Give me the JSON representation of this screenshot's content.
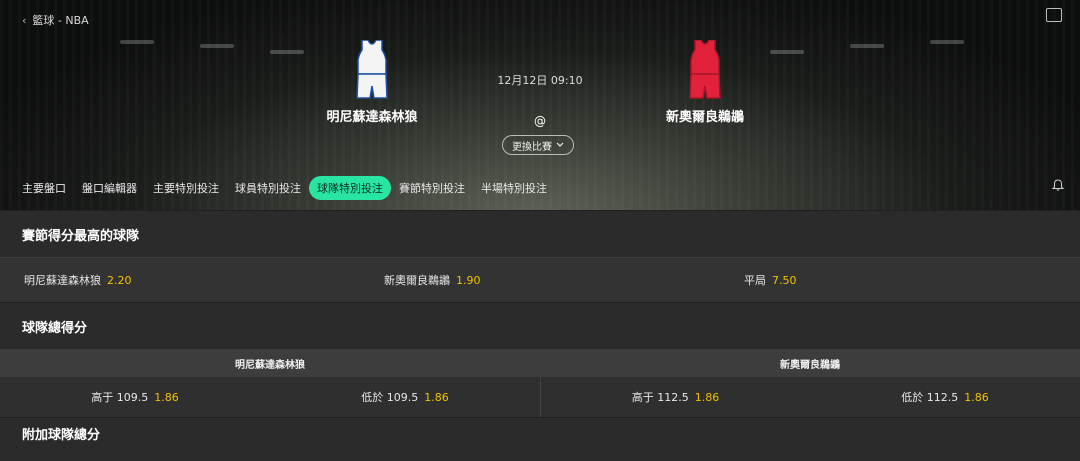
{
  "breadcrumb": "籃球 - NBA",
  "home_team": {
    "name": "明尼蘇達森林狼",
    "jersey_color": "#f4f4f4",
    "trim_color": "#1f4fa0"
  },
  "away_team": {
    "name": "新奧爾良鵜鶘",
    "jersey_color": "#e2223a",
    "trim_color": "#a8162a"
  },
  "match_time": "12月12日 09:10",
  "at_symbol": "@",
  "switch_match_label": "更換比賽",
  "tabs": [
    {
      "label": "主要盤口",
      "active": false
    },
    {
      "label": "盤口編輯器",
      "active": false
    },
    {
      "label": "主要特別投注",
      "active": false
    },
    {
      "label": "球員特別投注",
      "active": false
    },
    {
      "label": "球隊特別投注",
      "active": true
    },
    {
      "label": "賽節特別投注",
      "active": false
    },
    {
      "label": "半場特別投注",
      "active": false
    }
  ],
  "accent_color": "#28e6a2",
  "odds_color": "#f2c200",
  "section_top_quarter": {
    "title": "賽節得分最高的球隊",
    "options": [
      {
        "label": "明尼蘇達森林狼",
        "odds": "2.20"
      },
      {
        "label": "新奧爾良鵜鶘",
        "odds": "1.90"
      },
      {
        "label": "平局",
        "odds": "7.50"
      }
    ]
  },
  "section_team_total": {
    "title": "球隊總得分",
    "teams": [
      "明尼蘇達森林狼",
      "新奧爾良鵜鶘"
    ],
    "lines": [
      {
        "label": "高于 109.5",
        "odds": "1.86"
      },
      {
        "label": "低於 109.5",
        "odds": "1.86"
      },
      {
        "label": "高于 112.5",
        "odds": "1.86"
      },
      {
        "label": "低於 112.5",
        "odds": "1.86"
      }
    ]
  },
  "section_alt_total": {
    "title": "附加球隊總分"
  }
}
